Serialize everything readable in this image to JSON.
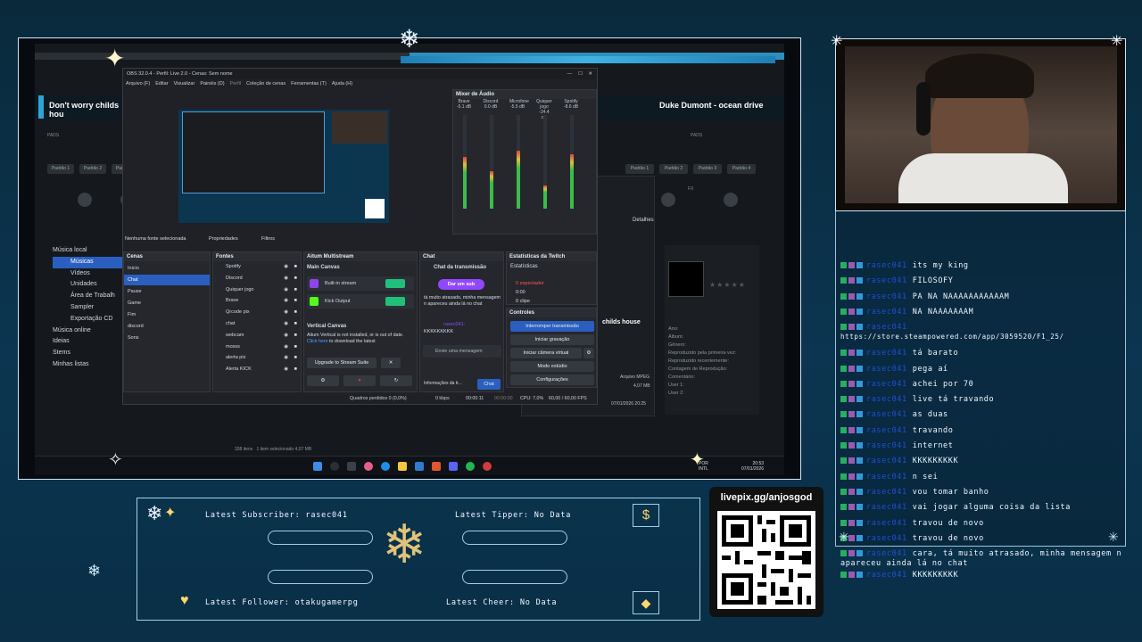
{
  "colors": {
    "accent_blue": "#2a5fbf",
    "frame_line": "#cfe6f5",
    "chat_username": "#1e4fd6",
    "live_red": "#c0392b"
  },
  "dj_app": {
    "deck_left": {
      "title": "Don't worry childs hou"
    },
    "deck_right": {
      "artist": "Duke Dumont",
      "title": "ocean drive"
    },
    "pads_label": "PADS",
    "fx_label": "FX",
    "pad_buttons": [
      "Padrão 1",
      "Padrão 2",
      "Padrão 3",
      "Padrão 4"
    ],
    "browser_items": [
      "Música local",
      "Músicas",
      "Vídeos",
      "Unidades",
      "Área de Trabalh",
      "Sampler",
      "Exportação CD",
      "Música online",
      "Ideias",
      "Stems",
      "Minhas listas"
    ],
    "details_tab": "Detalhes",
    "file_info": {
      "name": "childs house",
      "kind": "Arquivo MPEG",
      "size": "4,07 MB",
      "date": "07/01/2026 20:25"
    },
    "metadata_fields": [
      "Ano:",
      "Álbum:",
      "Gênero:",
      "Reproduzido pela primeira vez:",
      "Reproduzido recentemente:",
      "Contagem de Reprodução:",
      "Comentário:",
      "User 1:",
      "User 2:"
    ],
    "status_bar": {
      "items": "338 itens",
      "selected": "1 item selecionado 4,07 MB"
    }
  },
  "obs": {
    "window_title": "OBS 32.0.4 - Perfil: Live 2.0 - Cenas: Sem nome",
    "menu": [
      "Arquivo (F)",
      "Editar",
      "Visualizar",
      "Painéis (D)",
      "Perfil",
      "Coleção de cenas",
      "Ferramentas (T)",
      "Ajuda (H)"
    ],
    "no_source_selected": "Nenhuma fonte selecionada",
    "properties_btn": "Propriedades",
    "filters_btn": "Filtros",
    "mixer": {
      "title": "Mixer de Áudio",
      "channels": [
        {
          "name": "Brave",
          "db": "-5.1 dB",
          "level": 0.55
        },
        {
          "name": "Discord",
          "db": "0.0 dB",
          "level": 0.4
        },
        {
          "name": "Microfone",
          "db": "-5.5 dB",
          "level": 0.62
        },
        {
          "name": "Quiquer jogo",
          "db": "-24.4 dB",
          "level": 0.25
        },
        {
          "name": "Spotify",
          "db": "-8.6 dB",
          "level": 0.58
        }
      ]
    },
    "scenes": {
      "title": "Cenas",
      "items": [
        "Inicio",
        "Chat",
        "Pause",
        "Game",
        "Fim",
        "discord",
        "Sons"
      ],
      "selected_index": 1
    },
    "sources": {
      "title": "Fontes",
      "items": [
        "Spotify",
        "Discord",
        "Quiquer jogo",
        "Brave",
        "Qrcode pix",
        "chat",
        "webcam",
        "mosss",
        "alerta pix",
        "Alerta KICK"
      ]
    },
    "multistream": {
      "title": "Aitum Multistream",
      "main_canvas": "Main Canvas",
      "outputs": [
        "Built-in stream",
        "Kick Output"
      ],
      "vertical_title": "Vertical Canvas",
      "vertical_msg": "Aitum Vertical is not installed, or is out of date.",
      "download_link": "Click here",
      "download_rest": "to download the latest",
      "upgrade_btn": "Upgrade to Stream Suite"
    },
    "chat": {
      "title": "Chat",
      "header": "Chat da transmissão",
      "sub_btn": "Dar um sub",
      "messages": [
        "tá muito atrasado, minha mensagem n apareceu ainda lá no chat",
        "rasec041:",
        "KKKKKKKKK"
      ],
      "input_placeholder": "Envie uma mensagem",
      "chat_btn": "Chat",
      "info_btn": "Informações da tr..."
    },
    "twitch_stats": {
      "title": "Estatísticas da Twitch",
      "subtitle": "Estatísticas",
      "viewers": "0 espectador",
      "uptime": "0:00",
      "clips": "0 clipe"
    },
    "controls": {
      "title": "Controles",
      "buttons": [
        "Interromper transmissão",
        "Iniciar gravação",
        "Iniciar câmera virtual",
        "Modo estúdio",
        "Configurações"
      ]
    },
    "status": {
      "dropped": "Quadros perdidos 0 (0,0%)",
      "kbps": "0 kbps",
      "live_time": "00:00:11",
      "rec_time": "00:00:00",
      "cpu": "CPU: 7,0%",
      "fps": "60,00 / 60,00 FPS"
    }
  },
  "taskbar": {
    "lang": "POR",
    "lang2": "INTL",
    "time": "20:53",
    "date": "07/01/2026"
  },
  "chat_overlay": {
    "messages": [
      {
        "user": "rasec041",
        "text": "its my king"
      },
      {
        "user": "rasec041",
        "text": "FILOSOFY"
      },
      {
        "user": "rasec041",
        "text": "PA NA NAAAAAAAAAAAM"
      },
      {
        "user": "rasec041",
        "text": "NA NAAAAAAAM"
      },
      {
        "user": "rasec041",
        "text": "https://store.steampowered.com/app/3059520/F1_25/",
        "wrap": true
      },
      {
        "user": "rasec041",
        "text": "tá barato"
      },
      {
        "user": "rasec041",
        "text": "pega aí"
      },
      {
        "user": "rasec041",
        "text": "achei por 70"
      },
      {
        "user": "rasec041",
        "text": "live tá travando"
      },
      {
        "user": "rasec041",
        "text": "as duas"
      },
      {
        "user": "rasec041",
        "text": "travando"
      },
      {
        "user": "rasec041",
        "text": "internet"
      },
      {
        "user": "rasec041",
        "text": "KKKKKKKKK"
      },
      {
        "user": "rasec041",
        "text": "n sei"
      },
      {
        "user": "rasec041",
        "text": "vou tomar banho"
      },
      {
        "user": "rasec041",
        "text": "vai jogar alguma coisa da lista"
      },
      {
        "user": "rasec041",
        "text": "travou de novo"
      },
      {
        "user": "rasec041",
        "text": "travou de novo"
      },
      {
        "user": "rasec041",
        "text": "cara, tá muito atrasado, minha mensagem n",
        "text2": "apareceu ainda lá no chat",
        "wrap": true
      },
      {
        "user": "rasec041",
        "text": "KKKKKKKKK"
      }
    ]
  },
  "alerts": {
    "latest_subscriber": "Latest Subscriber: rasec041",
    "latest_tipper": "Latest Tipper: No Data",
    "latest_follower": "Latest Follower: otakugamerpg",
    "latest_cheer": "Latest Cheer: No Data"
  },
  "donation": {
    "url": "livepix.gg/anjosgod"
  }
}
